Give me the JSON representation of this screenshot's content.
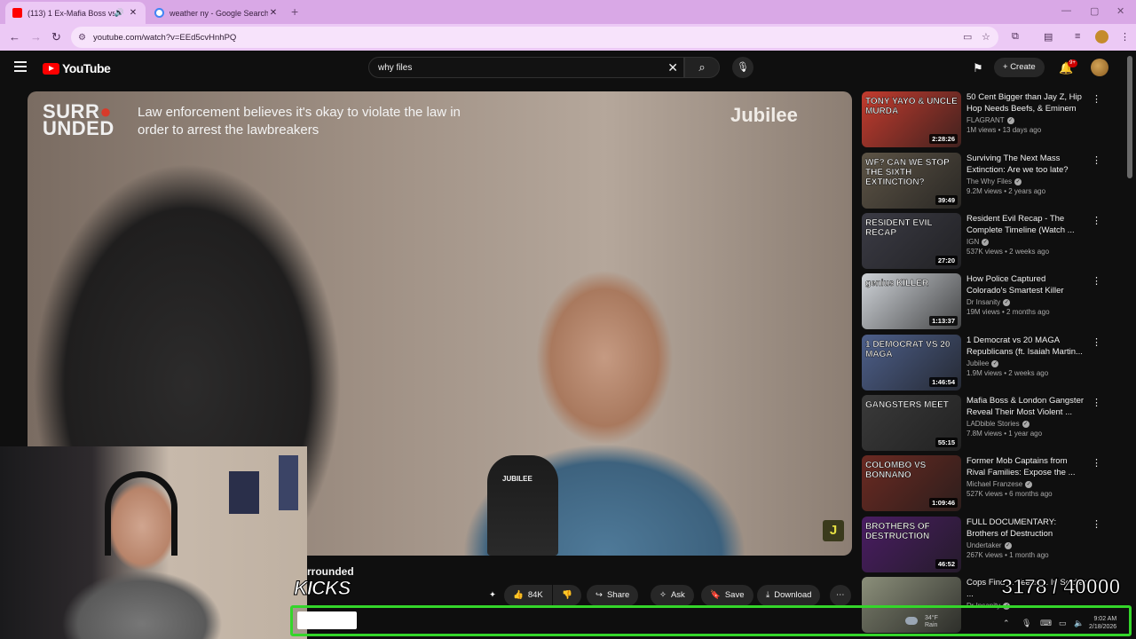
{
  "browser": {
    "tabs": [
      {
        "title": "(113) 1 Ex-Mafia Boss vs 20",
        "active": true
      },
      {
        "title": "weather ny - Google Search",
        "active": false
      }
    ],
    "url": "youtube.com/watch?v=EEd5cvHnhPQ"
  },
  "youtube": {
    "logo_text": "YouTube",
    "search_query": "why files",
    "create_label": "Create",
    "notification_count": "9+"
  },
  "player": {
    "overlay_brand_line1": "SURR",
    "overlay_brand_dot": "●",
    "overlay_brand_line2": "UNDED",
    "overlay_caption": "Law enforcement believes it's okay to violate the law in order to arrest the lawbreakers",
    "overlay_jubilee": "Jubilee",
    "overlay_j": "J",
    "mic_label": "JUBILEE"
  },
  "video": {
    "title_fragment": "rrounded",
    "stream_overlay_text": "KICKS",
    "actions": {
      "like_count": "84K",
      "share": "Share",
      "ask": "Ask",
      "save": "Save",
      "download": "Download"
    }
  },
  "stream_counter": "3178  / 40000",
  "taskbar": {
    "weather_temp": "34°F",
    "weather_cond": "Rain",
    "time": "9:02 AM",
    "date": "2/18/2026"
  },
  "recommendations": [
    {
      "title": "50 Cent Bigger than Jay Z, Hip Hop Needs Beefs, & Eminem i...",
      "channel": "FLAGRANT",
      "verified": true,
      "stats": "1M views • 13 days ago",
      "duration": "2:28:26",
      "thumb_text": "TONY YAYO & UNCLE MURDA",
      "thumb_color": "#c23b2e"
    },
    {
      "title": "Surviving The Next Mass Extinction: Are we too late?",
      "channel": "The Why Files",
      "verified": true,
      "stats": "9.2M views • 2 years ago",
      "duration": "39:49",
      "thumb_text": "WF? CAN WE STOP THE SIXTH EXTINCTION?",
      "thumb_color": "#5d5446"
    },
    {
      "title": "Resident Evil Recap - The Complete Timeline (Watch ...",
      "channel": "IGN",
      "verified": true,
      "stats": "537K views • 2 weeks ago",
      "duration": "27:20",
      "thumb_text": "RESIDENT EVIL RECAP",
      "thumb_color": "#3b3b45"
    },
    {
      "title": "How Police Captured Colorado's Smartest Killer",
      "channel": "Dr Insanity",
      "verified": true,
      "stats": "19M views • 2 months ago",
      "duration": "1:13:37",
      "thumb_text": "genius KILLER",
      "thumb_color": "#cfd3d8"
    },
    {
      "title": "1 Democrat vs 20 MAGA Republicans (ft. Isaiah Martin...",
      "channel": "Jubilee",
      "verified": true,
      "stats": "1.9M views • 2 weeks ago",
      "duration": "1:46:54",
      "thumb_text": "1 DEMOCRAT VS 20 MAGA",
      "thumb_color": "#4d5f8a"
    },
    {
      "title": "Mafia Boss & London Gangster Reveal Their Most Violent ...",
      "channel": "LADbible Stories",
      "verified": true,
      "stats": "7.8M views • 1 year ago",
      "duration": "55:15",
      "thumb_text": "GANGSTERS MEET",
      "thumb_color": "#3a3a3a"
    },
    {
      "title": "Former Mob Captains from Rival Families: Expose the ...",
      "channel": "Michael Franzese",
      "verified": true,
      "stats": "527K views • 6 months ago",
      "duration": "1:09:46",
      "thumb_text": "COLOMBO VS BONNANO",
      "thumb_color": "#6b2a22"
    },
    {
      "title": "FULL DOCUMENTARY: Brothers of Destruction",
      "channel": "Undertaker",
      "verified": true,
      "stats": "267K views • 1 month ago",
      "duration": "46:52",
      "thumb_text": "BROTHERS OF DESTRUCTION",
      "thumb_color": "#4a1d63"
    },
    {
      "title": "Cops Find ... Teens ... In Soldier ...",
      "channel": "Dr Insanity",
      "verified": true,
      "stats": "",
      "duration": "",
      "thumb_text": "",
      "thumb_color": "#8b8f7a"
    }
  ]
}
